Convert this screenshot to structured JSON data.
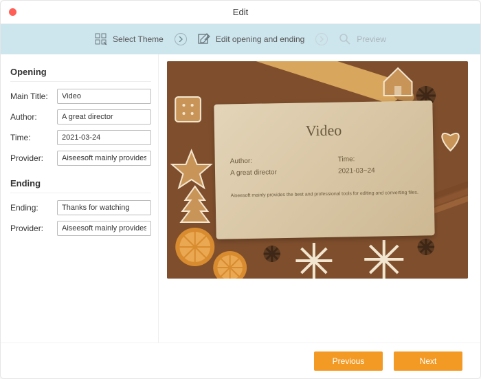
{
  "window": {
    "title": "Edit"
  },
  "stepper": {
    "step1": "Select Theme",
    "step2": "Edit opening and ending",
    "step3": "Preview"
  },
  "opening": {
    "heading": "Opening",
    "mainTitleLabel": "Main Title:",
    "mainTitle": "Video",
    "authorLabel": "Author:",
    "author": "A great director",
    "timeLabel": "Time:",
    "time": "2021-03-24",
    "providerLabel": "Provider:",
    "provider": "Aiseesoft mainly provides the b"
  },
  "ending": {
    "heading": "Ending",
    "endingLabel": "Ending:",
    "ending": "Thanks for watching",
    "providerLabel": "Provider:",
    "provider": "Aiseesoft mainly provides the b"
  },
  "preview": {
    "title": "Video",
    "authorLabel": "Author:",
    "author": "A great director",
    "timeLabel": "Time:",
    "time": "2021-03~24",
    "footer": "Aiseesoft mainly provides the best and professional tools for editing and converting files.."
  },
  "buttons": {
    "previous": "Previous",
    "next": "Next"
  }
}
